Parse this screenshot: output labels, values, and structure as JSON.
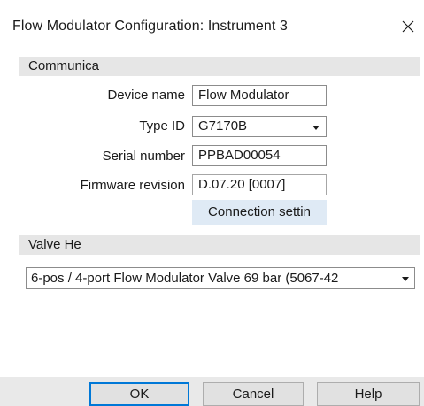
{
  "window": {
    "title": "Flow Modulator Configuration: Instrument 3",
    "close_icon": "close-icon"
  },
  "communication": {
    "header": "Communica",
    "device_name_label": "Device name",
    "device_name_value": "Flow Modulator",
    "type_id_label": "Type ID",
    "type_id_value": "G7170B",
    "serial_label": "Serial number",
    "serial_value": "PPBAD00054",
    "firmware_label": "Firmware revision",
    "firmware_value": "D.07.20 [0007]",
    "connection_button": "Connection settin"
  },
  "valve": {
    "header": "Valve He",
    "selected": "6-pos / 4-port Flow Modulator Valve 69 bar (5067-42"
  },
  "buttons": {
    "ok": "OK",
    "cancel": "Cancel",
    "help": "Help"
  },
  "colors": {
    "section_bg": "#e6e6e6",
    "connection_button_bg": "#dfeaf5",
    "default_button_border": "#0078d7"
  }
}
